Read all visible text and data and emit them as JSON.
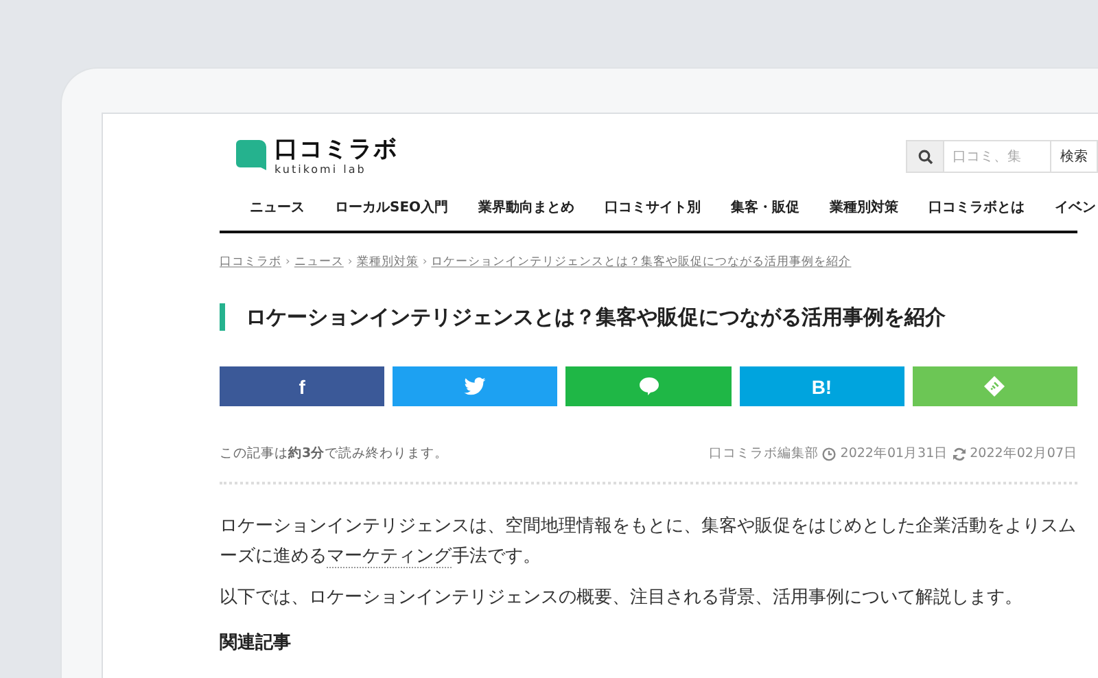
{
  "header": {
    "logo_name": "口コミラボ",
    "logo_tagline": "kutikomi lab",
    "search": {
      "placeholder": "口コミ、集",
      "button": "検索"
    }
  },
  "nav": [
    "ニュース",
    "ローカルSEO入門",
    "業界動向まとめ",
    "口コミサイト別",
    "集客・販促",
    "業種別対策",
    "口コミラボとは",
    "イベン"
  ],
  "breadcrumb": [
    {
      "label": "口コミラボ"
    },
    {
      "label": "ニュース",
      "separator": "›"
    },
    {
      "label": "業種別対策",
      "separator": "›"
    },
    {
      "label": "ロケーションインテリジェンスとは？集客や販促につながる活用事例を紹介",
      "separator": "›"
    }
  ],
  "title": "ロケーションインテリジェンスとは？集客や販促につながる活用事例を紹介",
  "share_buttons": [
    {
      "kind": "facebook",
      "label": "f",
      "color": "#3b5998"
    },
    {
      "kind": "twitter",
      "color": "#1da1f2"
    },
    {
      "kind": "line",
      "color": "#1fb746"
    },
    {
      "kind": "hatena",
      "label": "B!",
      "color": "#00a4de"
    },
    {
      "kind": "feedly",
      "color": "#6cc655"
    }
  ],
  "meta": {
    "reading_time": "この記事は**約3分**で読み終わります。",
    "author": "口コミラボ編集部",
    "published": "2022年01月31日",
    "updated": "2022年02月07日"
  },
  "body": [
    {
      "before": "ロケーションインテリジェンスは、空間地理情報をもとに、集客や販促をはじめとした企業活動をよりスムーズに進める",
      "link": "マーケティング",
      "after": "手法です。"
    },
    {
      "before": "以下では、ロケーションインテリジェンスの概要、注目される背景、活用事例について解説します。"
    }
  ],
  "related_heading": "関連記事"
}
